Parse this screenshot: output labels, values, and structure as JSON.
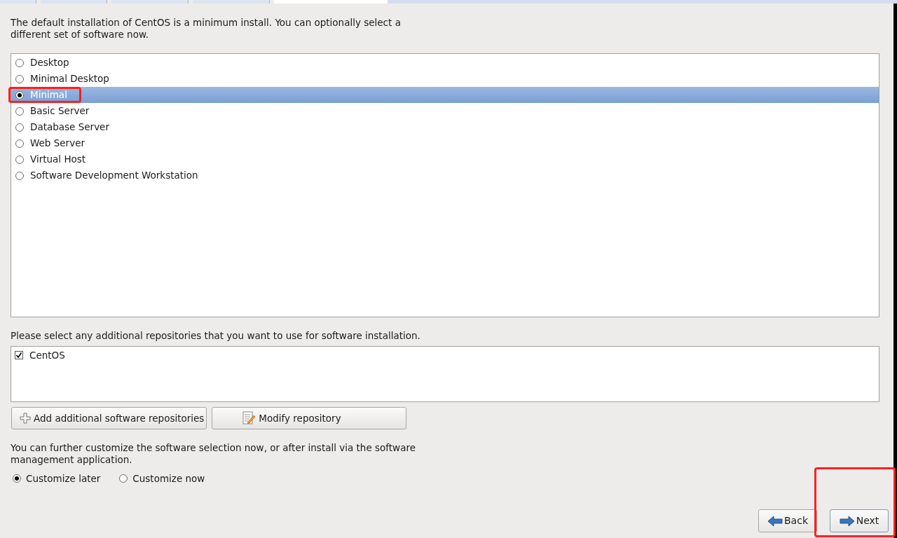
{
  "intro": "The default installation of CentOS is a minimum install. You can optionally select a different set of software now.",
  "software_sets": [
    {
      "label": "Desktop",
      "selected": false
    },
    {
      "label": "Minimal Desktop",
      "selected": false
    },
    {
      "label": "Minimal",
      "selected": true
    },
    {
      "label": "Basic Server",
      "selected": false
    },
    {
      "label": "Database Server",
      "selected": false
    },
    {
      "label": "Web Server",
      "selected": false
    },
    {
      "label": "Virtual Host",
      "selected": false
    },
    {
      "label": "Software Development Workstation",
      "selected": false
    }
  ],
  "repositories_prompt": "Please select any additional repositories that you want to use for software installation.",
  "repositories": [
    {
      "label": "CentOS",
      "checked": true
    }
  ],
  "repo_buttons": [
    {
      "kind": "add",
      "label": "Add additional software repositories"
    },
    {
      "kind": "modify",
      "label": "Modify repository"
    }
  ],
  "customize_prompt": "You can further customize the software selection now, or after install via the software management application.",
  "customize_options": [
    {
      "label": "Customize later",
      "selected": true
    },
    {
      "label": "Customize now",
      "selected": false
    }
  ],
  "nav_buttons": [
    {
      "kind": "back",
      "label": "Back"
    },
    {
      "kind": "next",
      "label": "Next"
    }
  ]
}
